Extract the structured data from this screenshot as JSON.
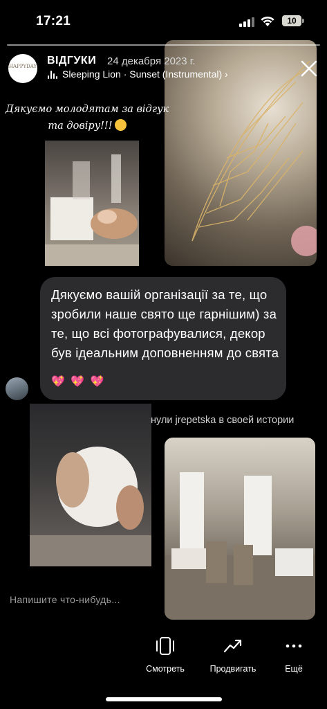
{
  "status_bar": {
    "time": "17:21",
    "battery": "10"
  },
  "story": {
    "account_name": "ВІДГУКИ",
    "post_date": "24 декабря 2023 г.",
    "music": "Sleeping Lion · Sunset (Instrumental) ›",
    "avatar_logo_text": "HAPPYDAY",
    "thanks_line1": "Дякуємо молодятам за відгук",
    "thanks_line2": "та довіру!!!",
    "comment_text": "Дякуємо вашій організації за те, що зробили наше свято ще гарнішим) за те, що всі фотографувалися, декор був ідеальним доповненням до свята",
    "hearts": [
      "💖",
      "💖",
      "💖"
    ],
    "mention": "нули jrepetska в своей истории",
    "reply_placeholder": "Напишите что-нибудь..."
  },
  "actions": [
    {
      "label": "Смотреть",
      "icon": "view-icon"
    },
    {
      "label": "Продвигать",
      "icon": "promote-icon"
    },
    {
      "label": "Ещё",
      "icon": "more-icon"
    }
  ],
  "colors": {
    "bubble": "#2c2c2e",
    "background": "#000000",
    "emoji": "#f7c23b"
  }
}
